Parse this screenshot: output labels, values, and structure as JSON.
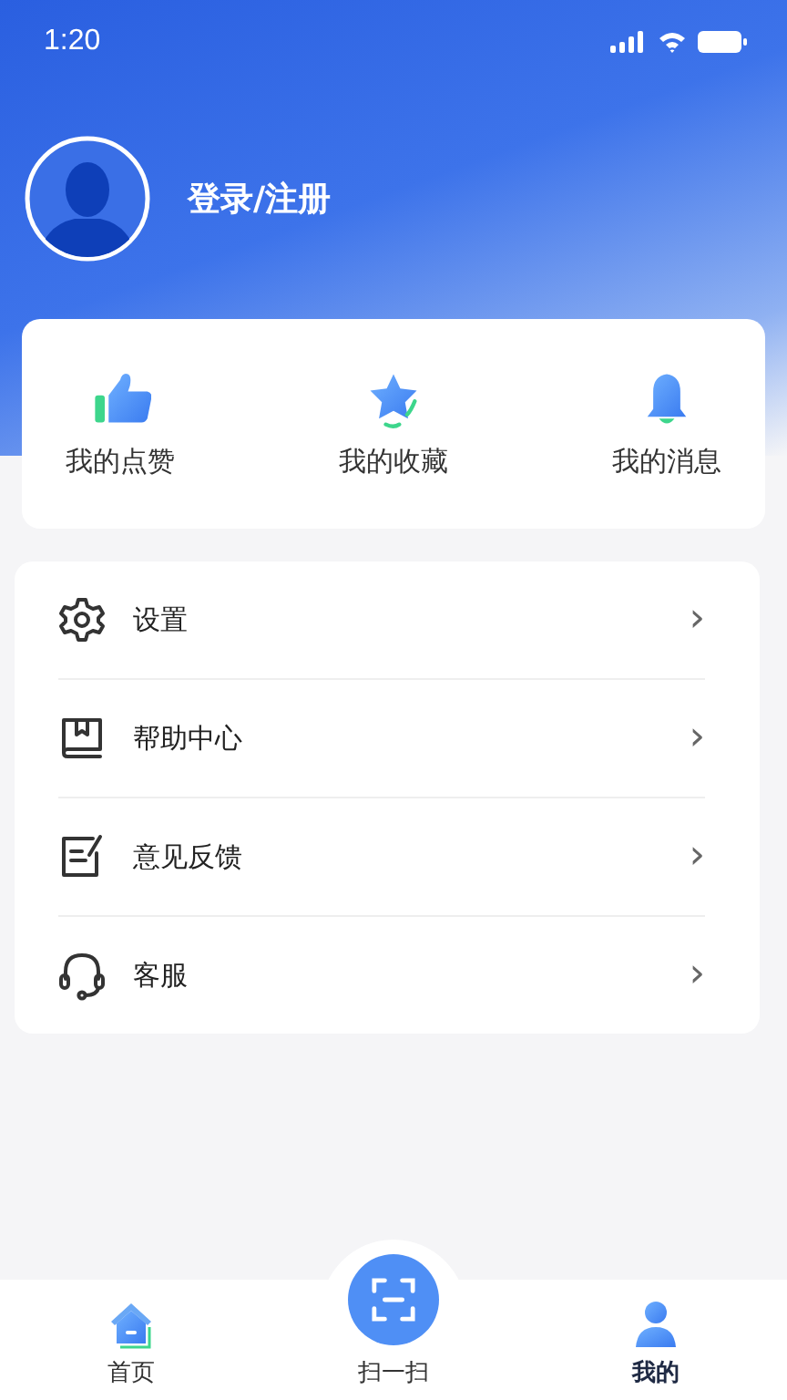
{
  "status_bar": {
    "time": "1:20"
  },
  "profile": {
    "login_label": "登录/注册"
  },
  "shortcuts": [
    {
      "kind": "like",
      "label": "我的点赞"
    },
    {
      "kind": "favorite",
      "label": "我的收藏"
    },
    {
      "kind": "message",
      "label": "我的消息"
    }
  ],
  "menu": [
    {
      "kind": "settings",
      "label": "设置",
      "chevron": "›"
    },
    {
      "kind": "help",
      "label": "帮助中心",
      "chevron": "›"
    },
    {
      "kind": "feedback",
      "label": "意见反馈",
      "chevron": "›"
    },
    {
      "kind": "service",
      "label": "客服",
      "chevron": "›"
    }
  ],
  "tab_bar": [
    {
      "kind": "home",
      "label": "首页",
      "selected": false
    },
    {
      "kind": "scan",
      "label": "扫一扫",
      "selected": false
    },
    {
      "kind": "me",
      "label": "我的",
      "selected": true
    }
  ]
}
